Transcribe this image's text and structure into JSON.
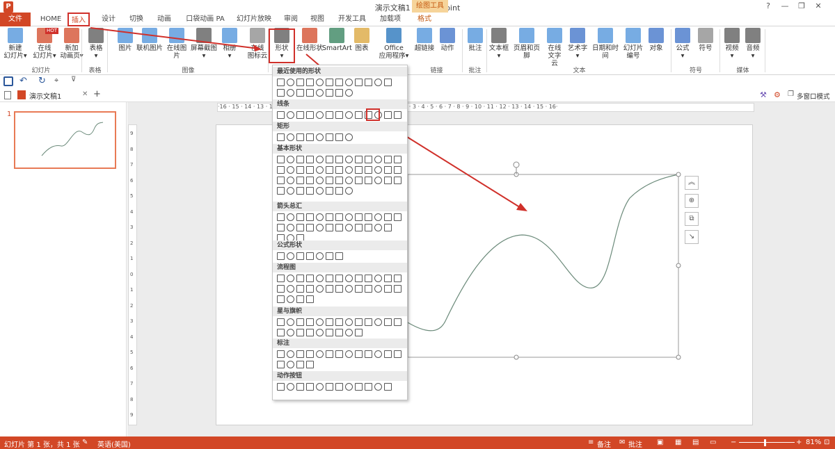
{
  "titlebar": {
    "title": "演示文稿1 - PowerPoint",
    "tool_header": "绘图工具",
    "help": "?",
    "minimize": "—",
    "restore": "❐",
    "close": "✕"
  },
  "tabs": [
    "文件",
    "HOME",
    "插入",
    "设计",
    "切换",
    "动画",
    "口袋动画 PA",
    "幻灯片放映",
    "审阅",
    "视图",
    "开发工具",
    "加载项",
    "格式"
  ],
  "ribbon": {
    "buttons": [
      {
        "l1": "新建",
        "l2": "幻灯片▾",
        "icon": "new-slide-icon"
      },
      {
        "l1": "在线",
        "l2": "幻灯片▾",
        "badge": "HOT",
        "icon": "online-slide-icon"
      },
      {
        "l1": "新加",
        "l2": "动画页▾",
        "icon": "new-anim-page-icon"
      },
      {
        "l1": "表格",
        "l2": "▾",
        "icon": "table-icon"
      },
      {
        "l1": "图片",
        "l2": "",
        "icon": "picture-icon"
      },
      {
        "l1": "联机图片",
        "l2": "",
        "icon": "online-picture-icon"
      },
      {
        "l1": "在线图片",
        "l2": "",
        "icon": "online-image-icon"
      },
      {
        "l1": "屏幕截图",
        "l2": "▾",
        "icon": "screenshot-icon"
      },
      {
        "l1": "相册",
        "l2": "▾",
        "icon": "album-icon"
      },
      {
        "l1": "在线",
        "l2": "图标云",
        "icon": "icon-cloud-icon"
      },
      {
        "l1": "形状",
        "l2": "▾",
        "icon": "shapes-icon"
      },
      {
        "l1": "在线形状",
        "l2": "",
        "icon": "online-shape-icon"
      },
      {
        "l1": "SmartArt",
        "l2": "",
        "icon": "smartart-icon"
      },
      {
        "l1": "图表",
        "l2": "",
        "icon": "chart-icon"
      },
      {
        "l1": "Office",
        "l2": "应用程序▾",
        "icon": "office-apps-icon"
      },
      {
        "l1": "超链接",
        "l2": "",
        "icon": "hyperlink-icon"
      },
      {
        "l1": "动作",
        "l2": "",
        "icon": "action-icon"
      },
      {
        "l1": "批注",
        "l2": "",
        "icon": "comment-icon"
      },
      {
        "l1": "文本框",
        "l2": "▾",
        "icon": "textbox-icon"
      },
      {
        "l1": "页眉和页脚",
        "l2": "",
        "icon": "header-footer-icon"
      },
      {
        "l1": "在线",
        "l2": "文字云",
        "icon": "word-cloud-icon"
      },
      {
        "l1": "艺术字",
        "l2": "▾",
        "icon": "wordart-icon"
      },
      {
        "l1": "日期和时间",
        "l2": "",
        "icon": "datetime-icon"
      },
      {
        "l1": "幻灯片",
        "l2": "编号",
        "icon": "slide-number-icon"
      },
      {
        "l1": "对象",
        "l2": "",
        "icon": "object-icon"
      },
      {
        "l1": "公式",
        "l2": "▾",
        "icon": "equation-icon"
      },
      {
        "l1": "符号",
        "l2": "",
        "icon": "symbol-icon"
      },
      {
        "l1": "视频",
        "l2": "▾",
        "icon": "video-icon"
      },
      {
        "l1": "音频",
        "l2": "▾",
        "icon": "audio-icon"
      }
    ],
    "groups": [
      "幻灯片",
      "表格",
      "图像",
      "链接",
      "批注",
      "文本",
      "符号",
      "媒体"
    ]
  },
  "doc_tab": {
    "name": "演示文稿1",
    "add": "+",
    "multiwindow": "多窗口模式"
  },
  "thumb_number": "1",
  "hruler_text": "·16 · 15 · 14 · 13 · 12 · 11 · 10 · 9 · 8 · 7 · 6 · 5 · 4 · 3 · 2 · 1 · 0 · 1 · 2 · 3 · 4 · 5 · 6 · 7 · 8 · 9 · 10 · 11 · 12 · 13 · 14 · 15 · 16·",
  "dropdown": {
    "sections": [
      "最近使用的形状",
      "线条",
      "矩形",
      "基本形状",
      "箭头总汇",
      "公式形状",
      "流程图",
      "星与旗帜",
      "标注",
      "动作按钮"
    ]
  },
  "float_buttons": [
    "︽",
    "⊕",
    "⧉",
    "↘"
  ],
  "status": {
    "slide_info": "幻灯片 第 1 张，共 1 张",
    "language": "英语(美国)",
    "notes": "备注",
    "comments": "批注",
    "zoom": "81%"
  }
}
